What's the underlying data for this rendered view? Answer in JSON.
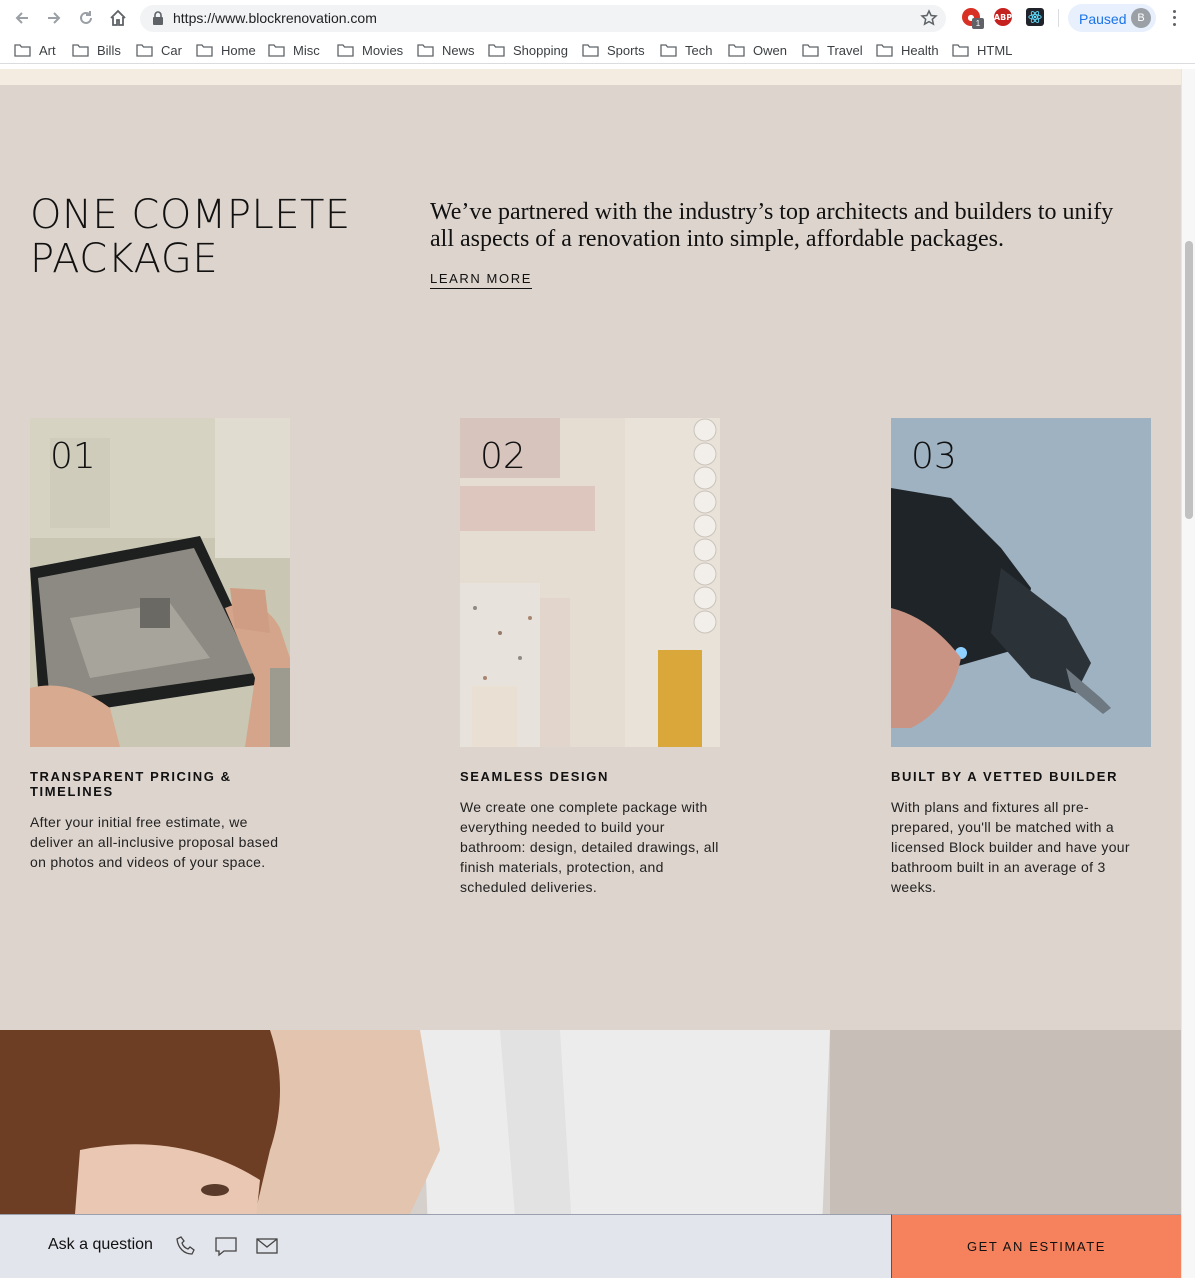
{
  "browser": {
    "url": "https://www.blockrenovation.com",
    "profile_label": "Paused",
    "profile_initial": "B",
    "extension_badge": "1",
    "extensions": [
      "ABP"
    ],
    "bookmarks": [
      "Art",
      "Bills",
      "Car",
      "Home",
      "Misc",
      "Movies",
      "News",
      "Shopping",
      "Sports",
      "Tech",
      "Owen",
      "Travel",
      "Health",
      "HTML"
    ]
  },
  "page": {
    "headline": "ONE COMPLETE PACKAGE",
    "intro": "We’ve partnered with the industry’s top architects and builders to unify all aspects of a renovation into simple, affordable packages.",
    "learn_more": "LEARN MORE",
    "features": [
      {
        "number": "01",
        "title": "TRANSPARENT PRICING & TIMELINES",
        "description": "After your initial free estimate, we deliver an all-inclusive proposal based on photos and videos of your space."
      },
      {
        "number": "02",
        "title": "SEAMLESS DESIGN",
        "description": "We create one complete package with everything needed to build your bathroom: design, detailed drawings, all finish materials, protection, and scheduled deliveries."
      },
      {
        "number": "03",
        "title": "BUILT BY A VETTED BUILDER",
        "description": "With plans and fixtures all pre-prepared, you'll be matched with a licensed Block builder and have your bathroom built in an average of 3 weeks."
      }
    ]
  },
  "footer_bar": {
    "ask_label": "Ask a question",
    "cta_label": "GET AN ESTIMATE"
  },
  "colors": {
    "section_bg": "#ddd4cd",
    "top_strip": "#f4ebe1",
    "cta_bg": "#f5825c",
    "ask_bar_bg": "#e3e5ec"
  }
}
